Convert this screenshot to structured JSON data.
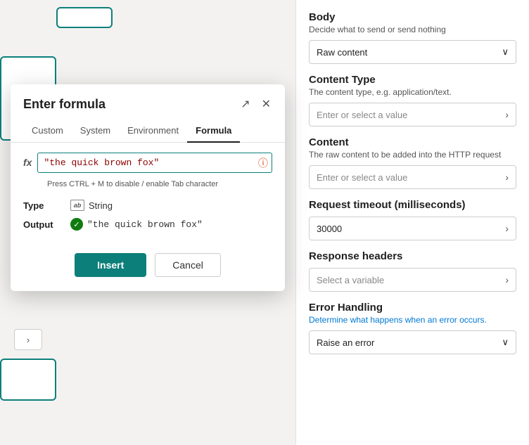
{
  "modal": {
    "title": "Enter formula",
    "tabs": [
      {
        "id": "custom",
        "label": "Custom",
        "active": false
      },
      {
        "id": "system",
        "label": "System",
        "active": false
      },
      {
        "id": "environment",
        "label": "Environment",
        "active": false
      },
      {
        "id": "formula",
        "label": "Formula",
        "active": true
      }
    ],
    "fx_label": "fx",
    "formula_value": "\"the quick brown fox\"",
    "formula_hint": "Press CTRL + M to disable / enable Tab character",
    "type_label": "Type",
    "type_value": "String",
    "output_label": "Output",
    "output_value": "\"the quick brown fox\"",
    "insert_button": "Insert",
    "cancel_button": "Cancel"
  },
  "right_panel": {
    "body_title": "Body",
    "body_subtitle": "Decide what to send or send nothing",
    "body_dropdown_value": "Raw content",
    "content_type_title": "Content Type",
    "content_type_subtitle": "The content type, e.g. application/text.",
    "content_type_placeholder": "Enter or select a value",
    "content_title": "Content",
    "content_subtitle": "The raw content to be added into the HTTP request",
    "content_placeholder": "Enter or select a value",
    "timeout_title": "Request timeout (milliseconds)",
    "timeout_value": "30000",
    "response_headers_title": "Response headers",
    "response_headers_placeholder": "Select a variable",
    "error_handling_title": "Error Handling",
    "error_handling_subtitle": "Determine what happens when an error occurs.",
    "error_handling_value": "Raise an error"
  },
  "icons": {
    "expand": "↗",
    "close": "✕",
    "chevron_down": "∨",
    "chevron_right": "›",
    "info": "ⓘ",
    "check": "✓",
    "dots": "⋮",
    "arrow_right": "›"
  }
}
